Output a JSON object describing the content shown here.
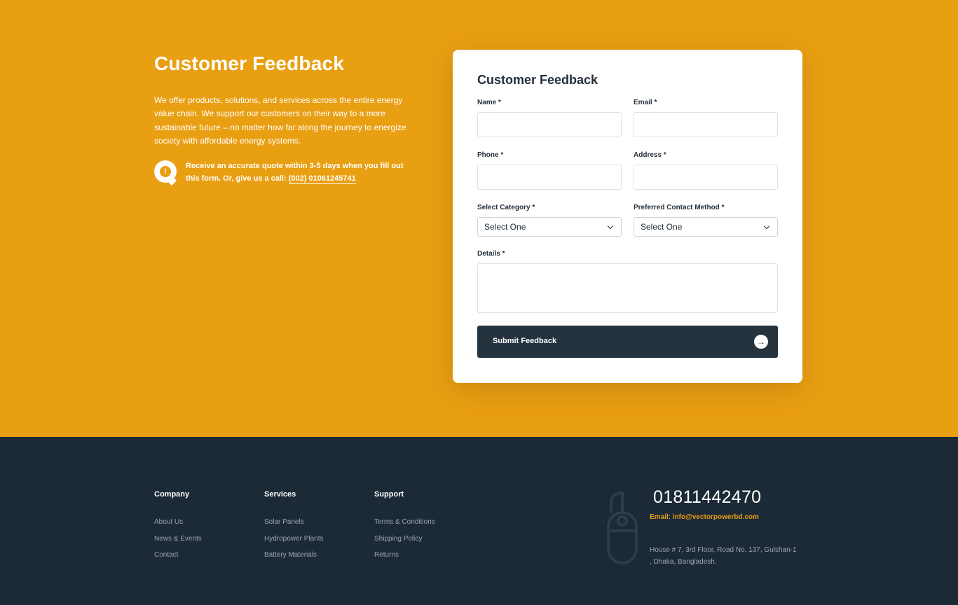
{
  "intro": {
    "title": "Customer Feedback",
    "lead": "We offer products, solutions, and services across the entire energy value chain. We support our customers on their way to a more sustainable future – no matter how far along the journey to energize society with affordable energy systems.",
    "quote_text": "Receive an accurate quote within 3-5 days when you fill out this form. Or, give us a call:",
    "quote_phone": "(002) 01061245741"
  },
  "form": {
    "title": "Customer Feedback",
    "name_label": "Name *",
    "email_label": "Email *",
    "phone_label": "Phone *",
    "address_label": "Address *",
    "category_label": "Select Category *",
    "category_value": "Select One",
    "contact_method_label": "Preferred Contact Method *",
    "contact_method_value": "Select One",
    "details_label": "Details *",
    "submit_label": "Submit Feedback"
  },
  "footer": {
    "company": {
      "title": "Company",
      "items": [
        "About Us",
        "News & Events",
        "Contact"
      ]
    },
    "services": {
      "title": "Services",
      "items": [
        "Solar Panels",
        "Hydropower Plants",
        "Battery Materials"
      ]
    },
    "support": {
      "title": "Support",
      "items": [
        "Terms & Conditions",
        "Shipping Policy",
        "Returns"
      ]
    },
    "phone": "01811442470",
    "email": "Email: info@vectorpowerbd.com",
    "address": "House # 7, 3rd Floor, Road No. 137, Gulshan-1 , Dhaka, Bangladesh."
  },
  "colors": {
    "accent": "#e99f12",
    "dark": "#1c2936",
    "button": "#25333f"
  },
  "icons": {
    "quote": "alert-chat-icon",
    "submit": "arrow-right-icon",
    "contact": "mouse-phone-icon"
  }
}
